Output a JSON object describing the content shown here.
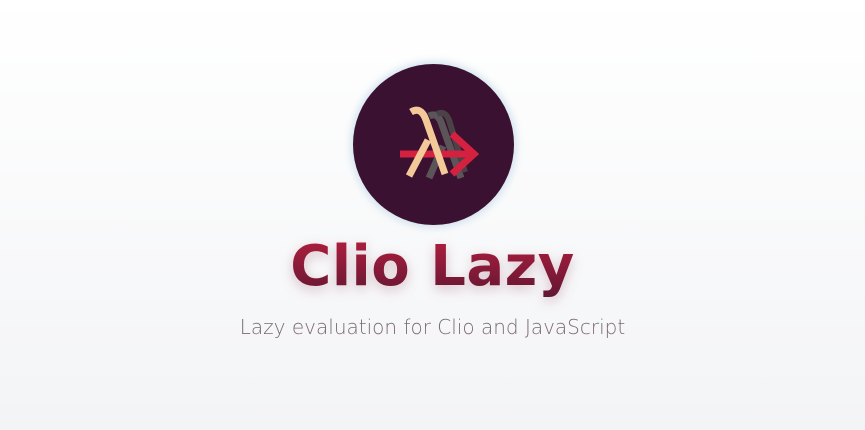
{
  "hero": {
    "title": "Clio Lazy",
    "tagline": "Lazy evaluation for Clio and JavaScript"
  },
  "logo": {
    "icon": "lambda-arrow-icon",
    "glyph": "λ",
    "colors": {
      "circle": "#3a1130",
      "lambda_front": "#f3c99a",
      "lambda_back": "#5b5458",
      "arrow": "#d4213f"
    }
  },
  "colors": {
    "title_top": "#b81f3f",
    "title_bottom": "#5a1632",
    "tagline": "#7a6a78"
  }
}
